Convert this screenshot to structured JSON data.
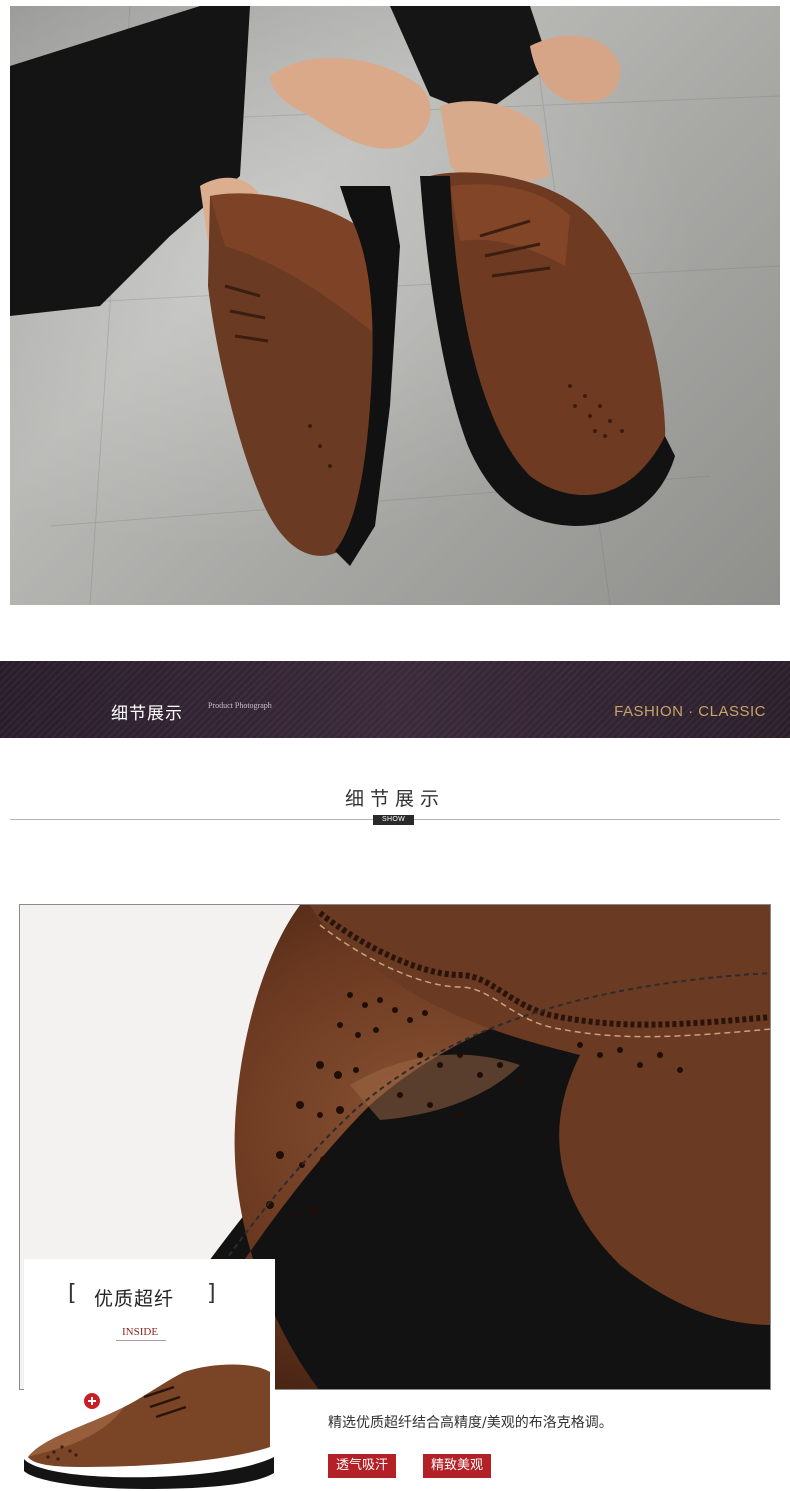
{
  "banner": {
    "title": "细节展示",
    "subtitle": "Product Photograph",
    "right_text": "FASHION · CLASSIC"
  },
  "section": {
    "title": "细节展示",
    "badge": "SHOW"
  },
  "inset": {
    "title": "优质超纤",
    "bracket_left": "[",
    "bracket_right": "]",
    "label": "INSIDE"
  },
  "description": {
    "text": "精选优质超纤结合高精度/美观的布洛克格调。",
    "tags": [
      "透气吸汗",
      "精致美观"
    ]
  },
  "colors": {
    "banner_bg": "#2f2230",
    "banner_accent": "#c9a46a",
    "tag_red": "#b32025",
    "leather_brown": "#6b3a22"
  }
}
